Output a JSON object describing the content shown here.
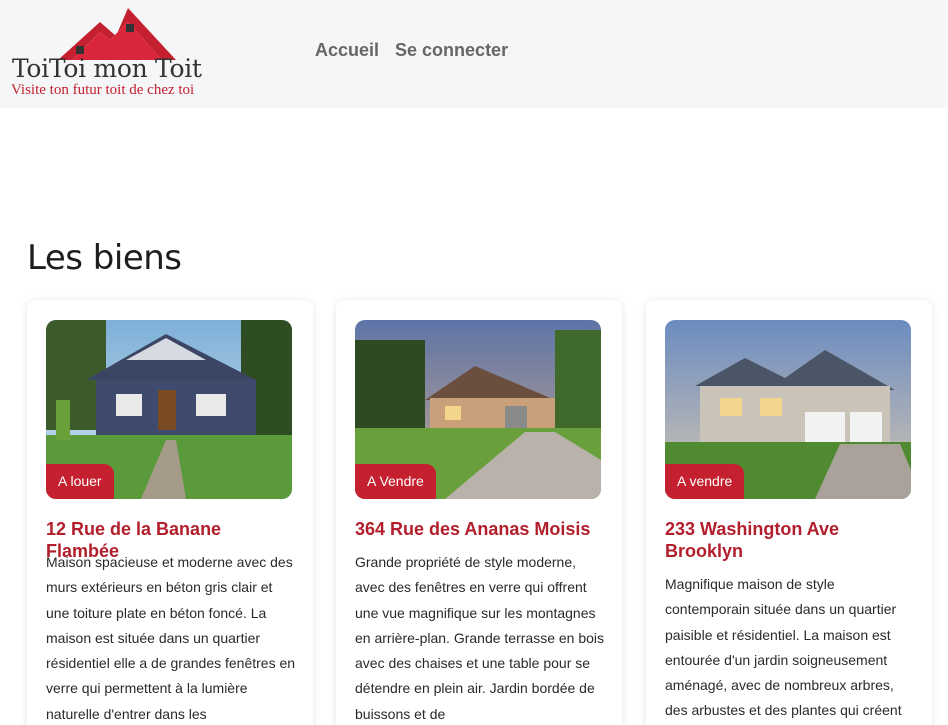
{
  "header": {
    "logo_title": "ToiToi mon Toit",
    "logo_tagline": "Visite ton futur toit de chez toi",
    "nav": [
      {
        "label": "Accueil"
      },
      {
        "label": "Se connecter"
      }
    ]
  },
  "section": {
    "title": "Les biens"
  },
  "colors": {
    "accent": "#c4202f",
    "title_red": "#b21e2c",
    "header_bg": "#f5f6f8"
  },
  "cards": [
    {
      "badge": "A louer",
      "title": "12 Rue de la Banane Flambée",
      "description": "Maison spacieuse et moderne avec des murs extérieurs en béton gris clair et une toiture plate en béton foncé. La maison est située dans un quartier résidentiel elle a de grandes fenêtres en verre qui permettent à la lumière naturelle d'entrer dans les"
    },
    {
      "badge": "A Vendre",
      "title": "364 Rue des Ananas Moisis",
      "description": "Grande propriété de style moderne, avec des fenêtres en verre qui offrent une vue magnifique sur les montagnes en arrière-plan. Grande terrasse en bois avec des chaises et une table pour se détendre en plein air. Jardin bordée de buissons et de"
    },
    {
      "badge": "A vendre",
      "title": "233 Washington Ave Brooklyn",
      "description": "Magnifique maison de style contemporain située dans un quartier paisible et résidentiel. La maison est entourée d'un jardin soigneusement aménagé, avec de nombreux arbres, des arbustes et des plantes qui créent"
    }
  ]
}
